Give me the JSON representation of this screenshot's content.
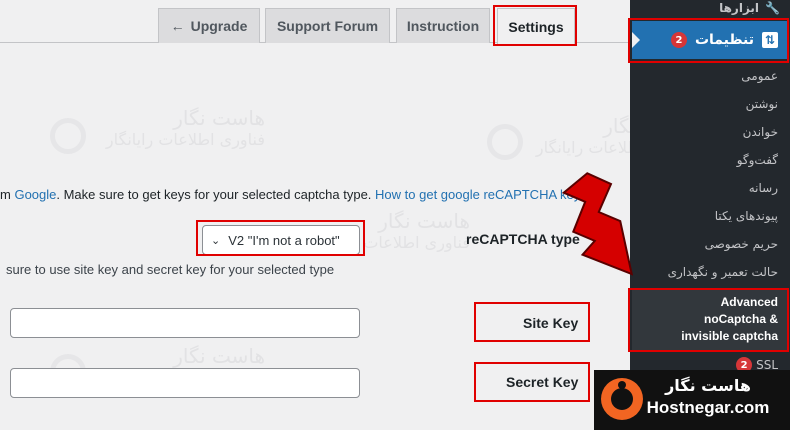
{
  "tabs": {
    "upgrade": {
      "arrow": "←",
      "label": "Upgrade"
    },
    "support": {
      "label": "Support Forum"
    },
    "instruction": {
      "label": "Instruction"
    },
    "settings": {
      "label": "Settings"
    }
  },
  "description": {
    "prefix": "m ",
    "google_link": "Google",
    "middle": ". Make sure to get keys for your selected captcha type. ",
    "howto_link": "How to get google reCAPTCHA keys"
  },
  "fields": {
    "captcha_type": {
      "label": "reCAPTCHA type",
      "value": "V2 \"I'm not a robot\"",
      "hint": "sure to use site key and secret key for your selected type"
    },
    "site_key": {
      "label": "Site Key",
      "value": ""
    },
    "secret_key": {
      "label": "Secret Key",
      "value": ""
    }
  },
  "watermark": {
    "line1": "هاست نگار",
    "line2": "فناوری اطلاعات رایانگار"
  },
  "sidebar": {
    "tools": {
      "label": "ابزارها",
      "icon": "wrench-icon"
    },
    "settings": {
      "label": "تنظیمات",
      "badge": "2",
      "icon": "settings-icon"
    },
    "items": [
      "عمومی",
      "نوشتن",
      "خواندن",
      "گفت‌وگو",
      "رسانه",
      "پیوندهای یکتا",
      "حریم خصوصی",
      "حالت تعمیر و نگهداری"
    ],
    "active_item": {
      "line1": "Advanced",
      "line2": "noCaptcha &",
      "line3": "invisible captcha"
    },
    "ssl": {
      "label": "SSL",
      "badge": "2"
    }
  },
  "brand": {
    "name": "هاست نگار",
    "url": "Hostnegar.com"
  },
  "colors": {
    "highlight": "#e00000",
    "wp_blue": "#2271b1",
    "sidebar_bg": "#23282d",
    "brand_orange": "#f26522"
  }
}
